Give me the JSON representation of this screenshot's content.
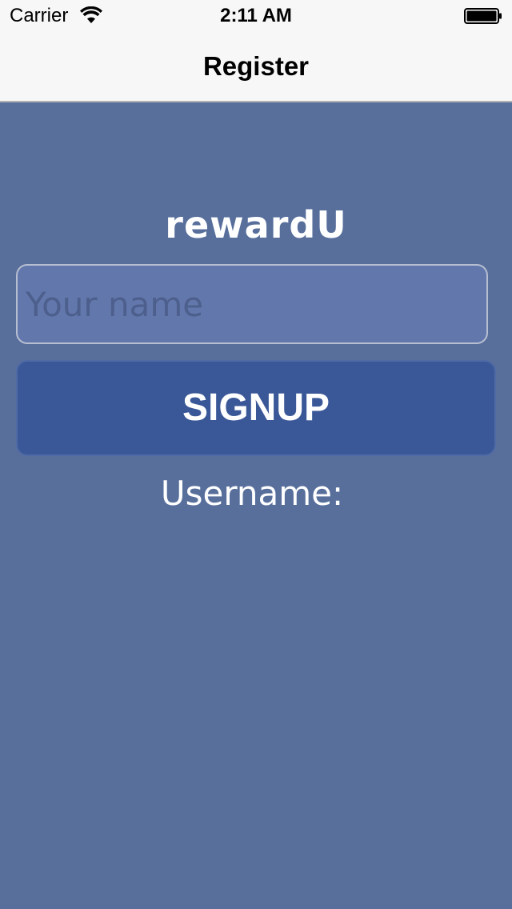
{
  "status_bar": {
    "carrier": "Carrier",
    "time": "2:11 AM",
    "wifi_icon": "wifi-icon",
    "battery_icon": "battery-icon"
  },
  "nav": {
    "title": "Register"
  },
  "main": {
    "app_title": "rewardU",
    "name_input": {
      "placeholder": "Your name",
      "value": ""
    },
    "signup_label": "SIGNUP",
    "username_label": "Username:"
  },
  "colors": {
    "background": "#586f9c",
    "input_background": "#6277ab",
    "button_background": "#3a5898",
    "navbar_background": "#f7f7f7"
  }
}
